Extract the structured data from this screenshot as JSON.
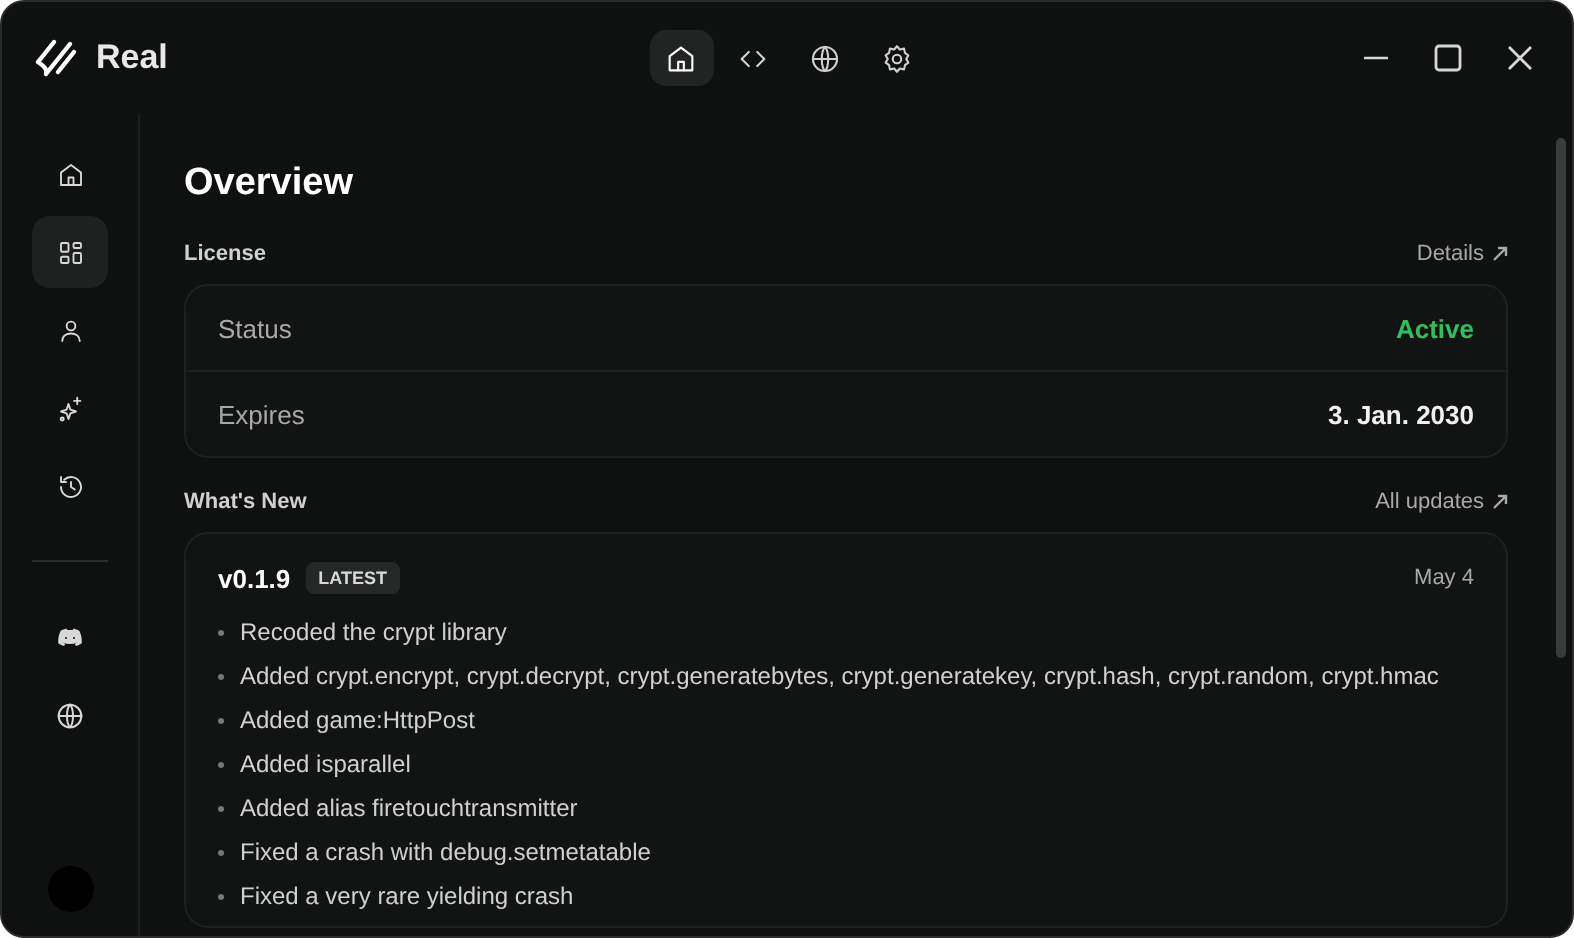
{
  "app": {
    "title": "Real"
  },
  "top_tabs": [
    {
      "kind": "home",
      "selected": true
    },
    {
      "kind": "code",
      "selected": false
    },
    {
      "kind": "globe",
      "selected": false
    },
    {
      "kind": "gear",
      "selected": false
    }
  ],
  "sidebar": {
    "items": [
      {
        "kind": "home",
        "selected": false
      },
      {
        "kind": "grid",
        "selected": true
      },
      {
        "kind": "user",
        "selected": false
      },
      {
        "kind": "sparkles",
        "selected": false
      },
      {
        "kind": "history",
        "selected": false
      }
    ],
    "links": [
      {
        "kind": "discord"
      },
      {
        "kind": "globe"
      }
    ]
  },
  "page": {
    "title": "Overview"
  },
  "license": {
    "heading": "License",
    "link": "Details",
    "rows": [
      {
        "label": "Status",
        "value": "Active",
        "kind": "status"
      },
      {
        "label": "Expires",
        "value": "3. Jan. 2030",
        "kind": "plain"
      }
    ]
  },
  "whats_new": {
    "heading": "What's New",
    "link": "All updates",
    "release": {
      "version": "v0.1.9",
      "badge": "LATEST",
      "date": "May 4",
      "changes": [
        "Recoded the crypt library",
        "Added crypt.encrypt, crypt.decrypt, crypt.generatebytes, crypt.generatekey, crypt.hash, crypt.random, crypt.hmac",
        "Added game:HttpPost",
        "Added isparallel",
        "Added alias firetouchtransmitter",
        "Fixed a crash with debug.setmetatable",
        "Fixed a very rare yielding crash"
      ]
    }
  }
}
